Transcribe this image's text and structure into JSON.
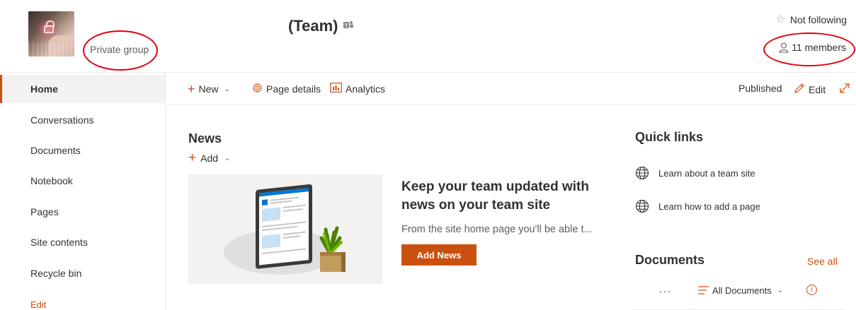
{
  "header": {
    "privacy_label": "Private group",
    "site_title": "(Team)",
    "teams_icon": "teams-icon",
    "follow_label": "Not following",
    "members_label": "11 members"
  },
  "nav": {
    "items": [
      {
        "label": "Home",
        "selected": true
      },
      {
        "label": "Conversations"
      },
      {
        "label": "Documents"
      },
      {
        "label": "Notebook"
      },
      {
        "label": "Pages"
      },
      {
        "label": "Site contents"
      },
      {
        "label": "Recycle bin"
      }
    ],
    "edit_label": "Edit"
  },
  "command_bar": {
    "new_label": "New",
    "page_details_label": "Page details",
    "analytics_label": "Analytics",
    "status_label": "Published",
    "edit_label": "Edit"
  },
  "news": {
    "title": "News",
    "add_label": "Add",
    "headline": "Keep your team updated with news on your team site",
    "description": "From the site home page you'll be able t...",
    "button_label": "Add News"
  },
  "quick_links": {
    "title": "Quick links",
    "items": [
      {
        "label": "Learn about a team site",
        "icon": "globe-icon"
      },
      {
        "label": "Learn how to add a page",
        "icon": "globe-icon"
      }
    ]
  },
  "documents": {
    "title": "Documents",
    "see_all_label": "See all",
    "more_label": "···",
    "view_label": "All Documents"
  },
  "colors": {
    "accent": "#ca5010",
    "annotation": "#e3000f"
  }
}
